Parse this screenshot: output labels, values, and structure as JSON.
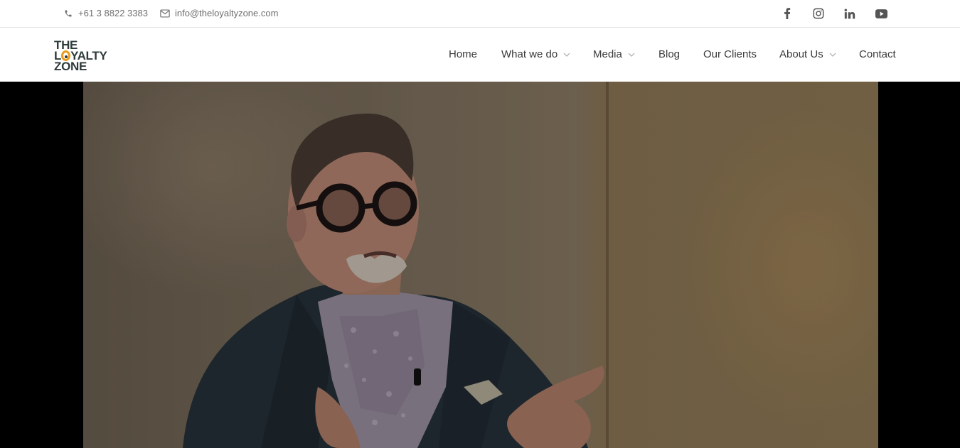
{
  "topbar": {
    "phone": "+61 3 8822 3383",
    "email": "info@theloyaltyzone.com",
    "social": [
      "facebook-icon",
      "instagram-icon",
      "linkedin-icon",
      "youtube-icon"
    ]
  },
  "logo": {
    "line1": "THE",
    "line2_pre": "L",
    "line2_post": "YALTY",
    "line3": "ZONE"
  },
  "nav": {
    "home": "Home",
    "what_we_do": "What we do",
    "media": "Media",
    "blog": "Blog",
    "our_clients": "Our Clients",
    "about_us": "About Us",
    "contact": "Contact"
  },
  "colors": {
    "accent": "#e99b1b",
    "text": "#3a3a3a",
    "muted": "#6f6f6f",
    "icon": "#555555"
  },
  "hero": {
    "media": "video-frame"
  }
}
